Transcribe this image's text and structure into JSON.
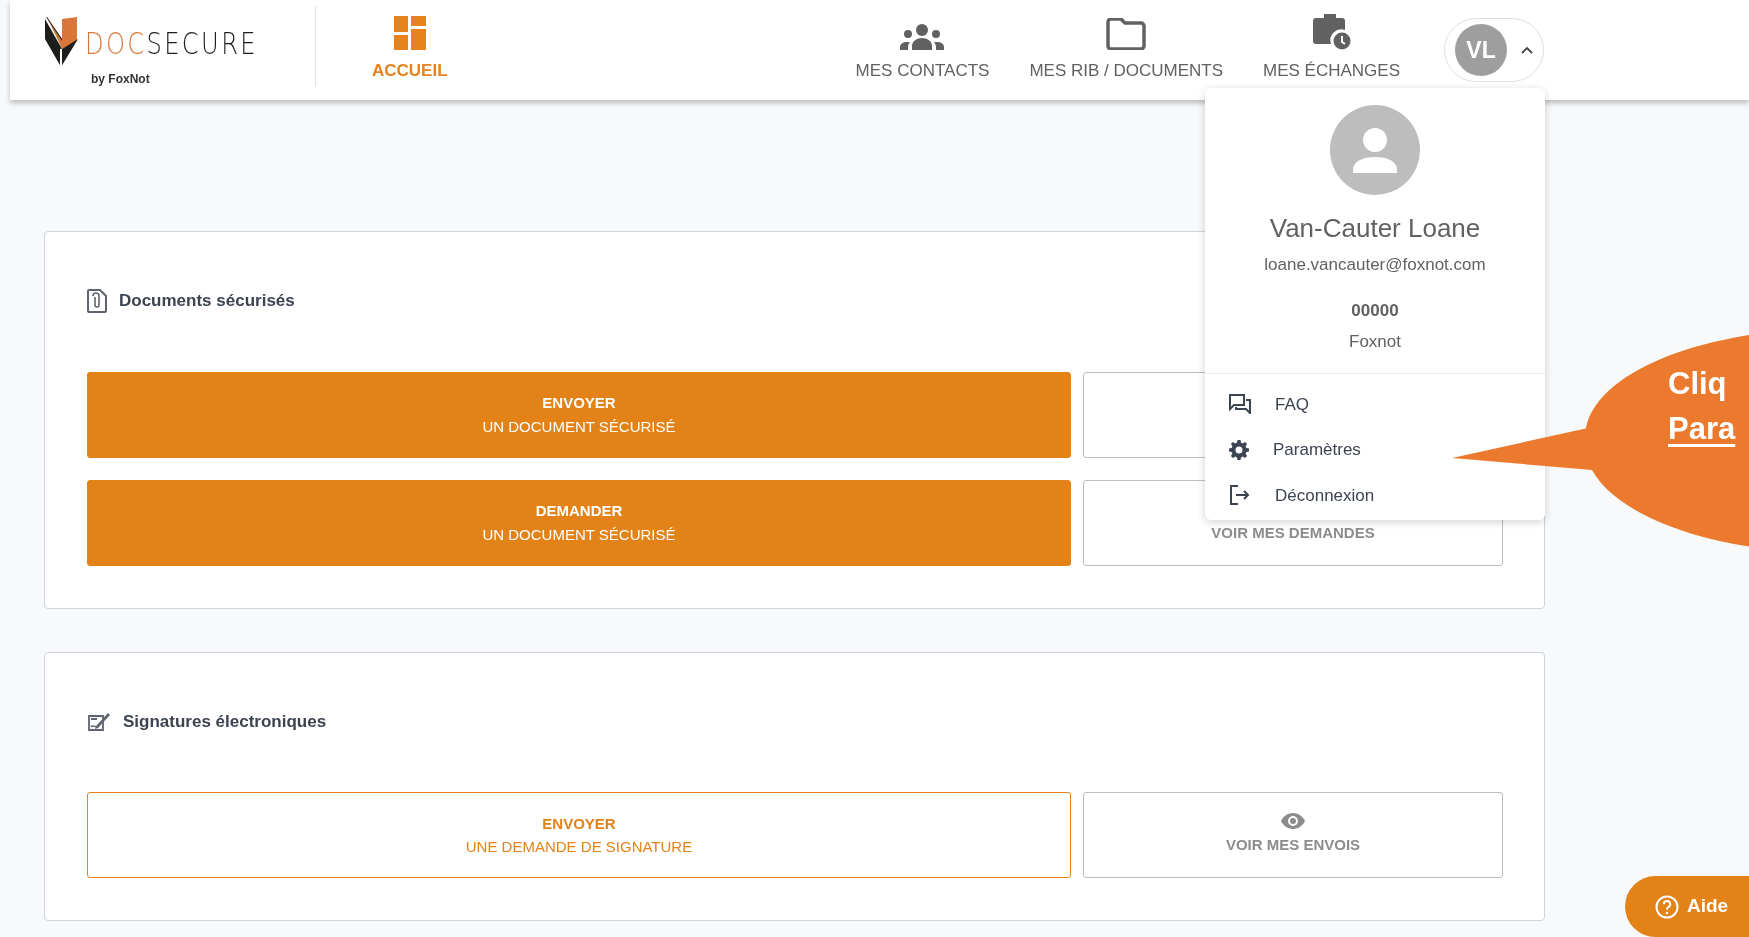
{
  "logo": {
    "word_part1": "DOC",
    "word_part2": "SECURE",
    "tagline": "by FoxNot"
  },
  "nav": [
    {
      "label": "ACCUEIL",
      "selected": true
    },
    {
      "label": "MES CONTACTS",
      "selected": false
    },
    {
      "label": "MES RIB / DOCUMENTS",
      "selected": false
    },
    {
      "label": "MES ÉCHANGES",
      "selected": false
    }
  ],
  "user_menu": {
    "initials": "VL",
    "expanded": true,
    "name": "Van-Cauter Loane",
    "email": "loane.vancauter@foxnot.com",
    "code": "00000",
    "organization": "Foxnot",
    "items": [
      {
        "label": "FAQ"
      },
      {
        "label": "Paramètres"
      },
      {
        "label": "Déconnexion"
      }
    ]
  },
  "sections": [
    {
      "title": "Documents sécurisés",
      "actions": [
        {
          "kind": "primary",
          "line1": "ENVOYER",
          "line2": "UN DOCUMENT SÉCURISÉ"
        },
        {
          "kind": "plain"
        },
        {
          "kind": "primary",
          "line1": "DEMANDER",
          "line2": "UN DOCUMENT SÉCURISÉ"
        },
        {
          "kind": "plain",
          "line1": "VOIR MES DEMANDES"
        }
      ]
    },
    {
      "title": "Signatures électroniques",
      "actions": [
        {
          "kind": "outline",
          "line1": "ENVOYER",
          "line2": "UNE DEMANDE DE SIGNATURE"
        },
        {
          "kind": "view",
          "line1": "VOIR MES ENVOIS"
        }
      ]
    }
  ],
  "callout": {
    "lines": [
      {
        "text": "Cliq",
        "underline": false
      },
      {
        "text": "Para",
        "underline": true
      }
    ]
  },
  "help_button": {
    "label": "Aide"
  }
}
